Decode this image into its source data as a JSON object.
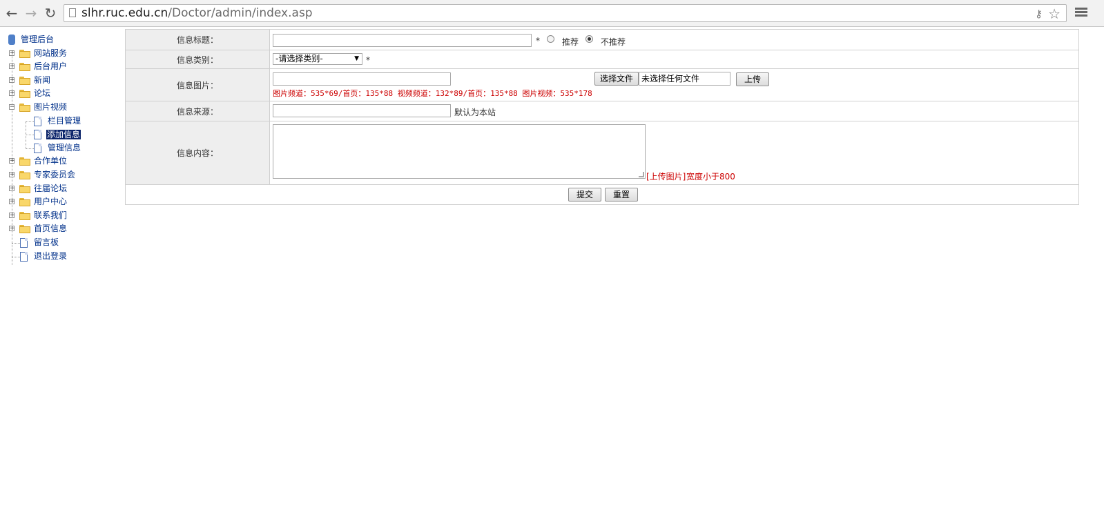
{
  "browser": {
    "url_host": "slhr.ruc.edu.cn",
    "url_path": "/Doctor/admin/index.asp"
  },
  "sidebar": {
    "root": "管理后台",
    "items": [
      {
        "label": "网站服务"
      },
      {
        "label": "后台用户"
      },
      {
        "label": "新闻"
      },
      {
        "label": "论坛"
      },
      {
        "label": "图片视频",
        "children": [
          {
            "label": "栏目管理"
          },
          {
            "label": "添加信息"
          },
          {
            "label": "管理信息"
          }
        ]
      },
      {
        "label": "合作单位"
      },
      {
        "label": "专家委员会"
      },
      {
        "label": "往届论坛"
      },
      {
        "label": "用户中心"
      },
      {
        "label": "联系我们"
      },
      {
        "label": "首页信息"
      },
      {
        "label": "留言板"
      },
      {
        "label": "退出登录"
      }
    ]
  },
  "form": {
    "title_label": "信息标题：",
    "title_value": "",
    "required_mark": "*",
    "recommend_label": "推荐",
    "not_recommend_label": "不推荐",
    "recommend_selected": "不推荐",
    "category_label": "信息类别：",
    "category_selected": "-请选择类别-",
    "image_label": "信息图片：",
    "image_value": "",
    "choose_file_label": "选择文件",
    "no_file_label": "未选择任何文件",
    "upload_label": "上传",
    "image_hint": "图片频道：535*69/首页：135*88 视频频道：132*89/首页：135*88 图片视频：535*178",
    "source_label": "信息来源：",
    "source_value": "",
    "source_hint": "默认为本站",
    "content_label": "信息内容：",
    "content_value": "",
    "upload_image_link": "[上传图片]",
    "width_hint": "宽度小于800",
    "submit_label": "提交",
    "reset_label": "重置"
  }
}
